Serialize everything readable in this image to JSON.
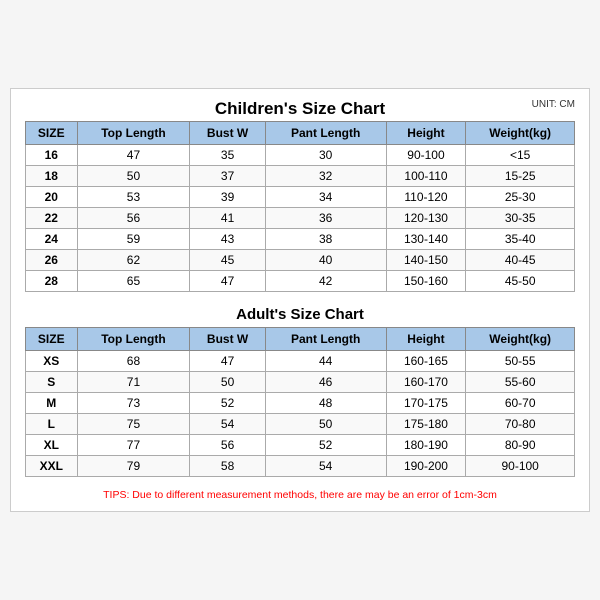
{
  "unit": "UNIT: CM",
  "children": {
    "title": "Children's Size Chart",
    "headers": [
      "SIZE",
      "Top Length",
      "Bust W",
      "Pant Length",
      "Height",
      "Weight(kg)"
    ],
    "rows": [
      [
        "16",
        "47",
        "35",
        "30",
        "90-100",
        "<15"
      ],
      [
        "18",
        "50",
        "37",
        "32",
        "100-110",
        "15-25"
      ],
      [
        "20",
        "53",
        "39",
        "34",
        "110-120",
        "25-30"
      ],
      [
        "22",
        "56",
        "41",
        "36",
        "120-130",
        "30-35"
      ],
      [
        "24",
        "59",
        "43",
        "38",
        "130-140",
        "35-40"
      ],
      [
        "26",
        "62",
        "45",
        "40",
        "140-150",
        "40-45"
      ],
      [
        "28",
        "65",
        "47",
        "42",
        "150-160",
        "45-50"
      ]
    ]
  },
  "adults": {
    "title": "Adult's Size Chart",
    "headers": [
      "SIZE",
      "Top Length",
      "Bust W",
      "Pant Length",
      "Height",
      "Weight(kg)"
    ],
    "rows": [
      [
        "XS",
        "68",
        "47",
        "44",
        "160-165",
        "50-55"
      ],
      [
        "S",
        "71",
        "50",
        "46",
        "160-170",
        "55-60"
      ],
      [
        "M",
        "73",
        "52",
        "48",
        "170-175",
        "60-70"
      ],
      [
        "L",
        "75",
        "54",
        "50",
        "175-180",
        "70-80"
      ],
      [
        "XL",
        "77",
        "56",
        "52",
        "180-190",
        "80-90"
      ],
      [
        "XXL",
        "79",
        "58",
        "54",
        "190-200",
        "90-100"
      ]
    ]
  },
  "tips": "TIPS: Due to different measurement methods, there are may be an error of 1cm-3cm"
}
